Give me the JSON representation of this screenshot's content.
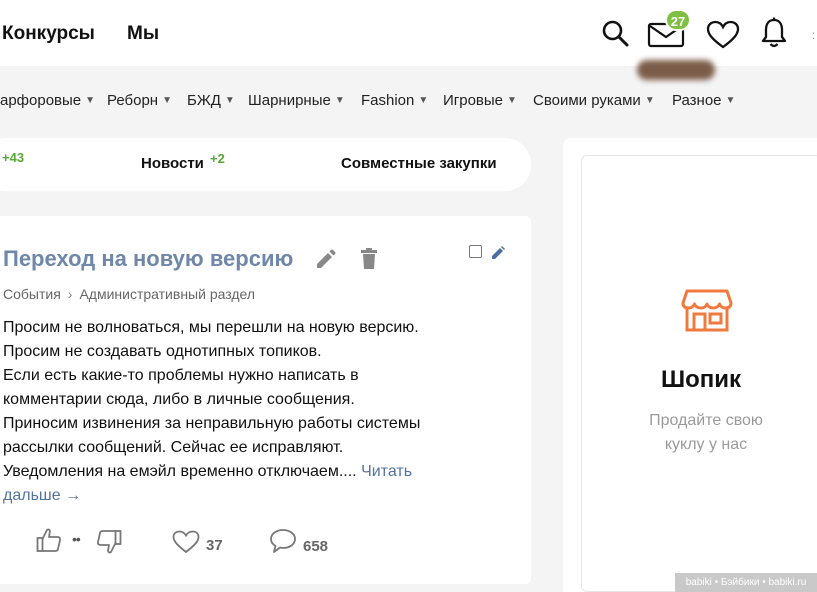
{
  "topbar": {
    "links": [
      "Конкурсы",
      "Мы"
    ],
    "mail_badge": "27",
    "icons": [
      "search-icon",
      "mail-icon",
      "heart-icon",
      "bell-icon"
    ]
  },
  "categories": [
    {
      "label": "арфоровые"
    },
    {
      "label": "Реборн"
    },
    {
      "label": "БЖД"
    },
    {
      "label": "Шарнирные"
    },
    {
      "label": "Fashion"
    },
    {
      "label": "Игровые"
    },
    {
      "label": "Своими руками"
    },
    {
      "label": "Разное"
    }
  ],
  "tabs": [
    {
      "label": "",
      "count": "+43"
    },
    {
      "label": "Новости",
      "count": "+2"
    },
    {
      "label": "Совместные закупки",
      "count": ""
    }
  ],
  "post": {
    "title": "Переход на новую версию",
    "breadcrumb": [
      "События",
      "Административный раздел"
    ],
    "body_lines": [
      "Просим не волноваться, мы перешли на новую версию.",
      "Просим не создавать однотипных топиков.",
      "Если есть какие-то проблемы нужно написать в",
      "комментарии сюда, либо в личные сообщения.",
      "Приносим извинения за неправильную работы системы",
      "рассылки сообщений. Сейчас ее исправляют.",
      "Уведомления на емэйл временно отключаем...."
    ],
    "read_more_1": "Читать",
    "read_more_2": "дальше →",
    "rating_dots": "••",
    "likes": "37",
    "comments": "658"
  },
  "sidebar": {
    "shop_title": "Шопик",
    "shop_sub_1": "Продайте свою",
    "shop_sub_2": "куклу у нас"
  },
  "watermark": "babiki • Бэйбики • babiki.ru",
  "colors": {
    "accent_title": "#6f87a8",
    "badge_green": "#7fc042",
    "count_green": "#5aa83a",
    "shop_orange": "#f07a3e",
    "link_blue": "#5473a0"
  }
}
